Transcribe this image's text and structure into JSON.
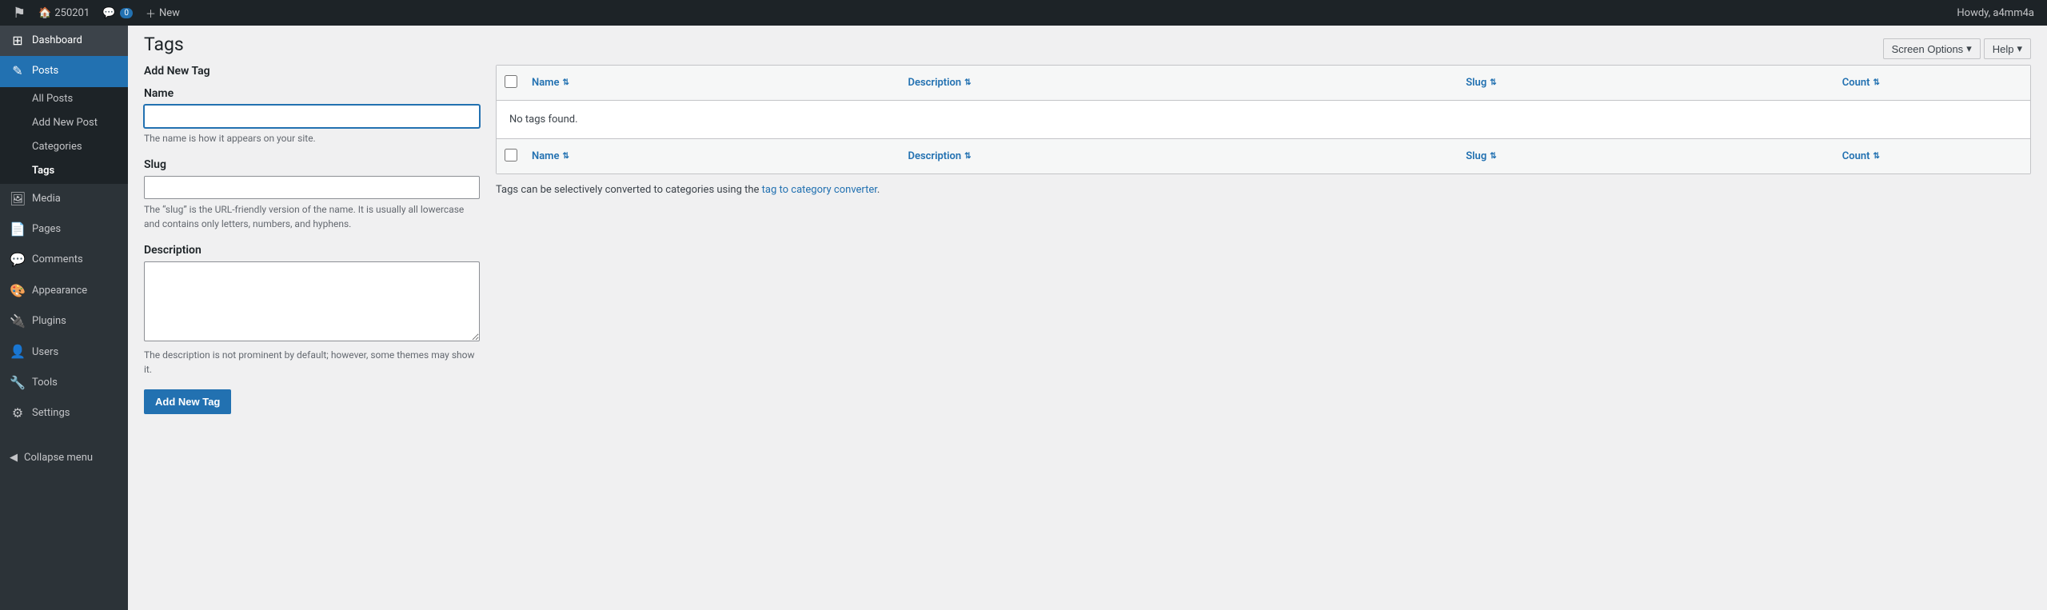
{
  "adminbar": {
    "site_name": "250201",
    "comment_count": "0",
    "new_label": "New",
    "howdy": "Howdy, a4mm4a"
  },
  "top_buttons": {
    "screen_options": "Screen Options",
    "help": "Help"
  },
  "sidebar": {
    "items": [
      {
        "id": "dashboard",
        "label": "Dashboard",
        "icon": "⊞",
        "active": false
      },
      {
        "id": "posts",
        "label": "Posts",
        "icon": "✎",
        "active": true
      }
    ],
    "posts_submenu": [
      {
        "id": "all-posts",
        "label": "All Posts",
        "active": false
      },
      {
        "id": "add-new-post",
        "label": "Add New Post",
        "active": false
      },
      {
        "id": "categories",
        "label": "Categories",
        "active": false
      },
      {
        "id": "tags",
        "label": "Tags",
        "active": true
      }
    ],
    "other_items": [
      {
        "id": "media",
        "label": "Media",
        "icon": "🖼"
      },
      {
        "id": "pages",
        "label": "Pages",
        "icon": "📄"
      },
      {
        "id": "comments",
        "label": "Comments",
        "icon": "💬"
      },
      {
        "id": "appearance",
        "label": "Appearance",
        "icon": "🎨"
      },
      {
        "id": "plugins",
        "label": "Plugins",
        "icon": "🔌"
      },
      {
        "id": "users",
        "label": "Users",
        "icon": "👤"
      },
      {
        "id": "tools",
        "label": "Tools",
        "icon": "🔧"
      },
      {
        "id": "settings",
        "label": "Settings",
        "icon": "⚙"
      }
    ],
    "collapse_label": "Collapse menu"
  },
  "page": {
    "title": "Tags",
    "form_title": "Add New Tag"
  },
  "form": {
    "name_label": "Name",
    "name_placeholder": "",
    "name_help": "The name is how it appears on your site.",
    "slug_label": "Slug",
    "slug_placeholder": "",
    "slug_help": "The “slug” is the URL-friendly version of the name. It is usually all lowercase and contains only letters, numbers, and hyphens.",
    "description_label": "Description",
    "description_placeholder": "",
    "description_help": "The description is not prominent by default; however, some themes may show it.",
    "submit_label": "Add New Tag"
  },
  "table": {
    "columns": [
      {
        "id": "name",
        "label": "Name"
      },
      {
        "id": "description",
        "label": "Description"
      },
      {
        "id": "slug",
        "label": "Slug"
      },
      {
        "id": "count",
        "label": "Count"
      }
    ],
    "empty_message": "No tags found.",
    "converter_text_before": "Tags can be selectively converted to categories using the ",
    "converter_link_text": "tag to category converter",
    "converter_text_after": "."
  }
}
